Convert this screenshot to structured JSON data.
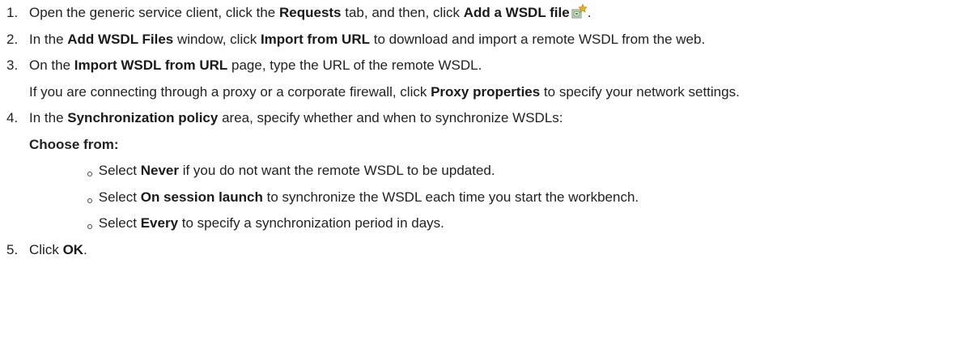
{
  "steps": [
    {
      "num": "1.",
      "parts": [
        "Open the generic service client, click the ",
        "Requests",
        " tab, and then, click  ",
        "Add a WSDL file",
        "."
      ]
    },
    {
      "num": "2.",
      "parts": [
        "In the ",
        "Add WSDL Files",
        " window, click ",
        "Import from URL",
        " to download and import a remote WSDL from the web."
      ]
    },
    {
      "num": "3.",
      "parts": [
        "On the ",
        "Import WSDL from URL",
        " page, type the URL of the remote WSDL."
      ],
      "note_parts": [
        "If you are connecting through a proxy or a corporate firewall, click ",
        "Proxy properties",
        " to specify your network settings."
      ]
    },
    {
      "num": "4.",
      "parts": [
        "In the ",
        "Synchronization policy",
        " area, specify whether and when to synchronize WSDLs:"
      ],
      "choose": "Choose from:",
      "options": [
        {
          "pre": "Select ",
          "bold": "Never",
          "post": " if you do not want the remote WSDL to be updated."
        },
        {
          "pre": "Select ",
          "bold": "On session launch",
          "post": " to synchronize the WSDL each time you start the workbench."
        },
        {
          "pre": "Select ",
          "bold": "Every",
          "post": " to specify a synchronization period in days."
        }
      ]
    },
    {
      "num": "5.",
      "parts": [
        "Click ",
        "OK",
        "."
      ]
    }
  ],
  "icons": {
    "add_wsdl": "add-wsdl-file-icon"
  },
  "colors": {
    "text": "#222222",
    "icon_star": "#e8b41c",
    "icon_sheet": "#4a8f3a"
  }
}
